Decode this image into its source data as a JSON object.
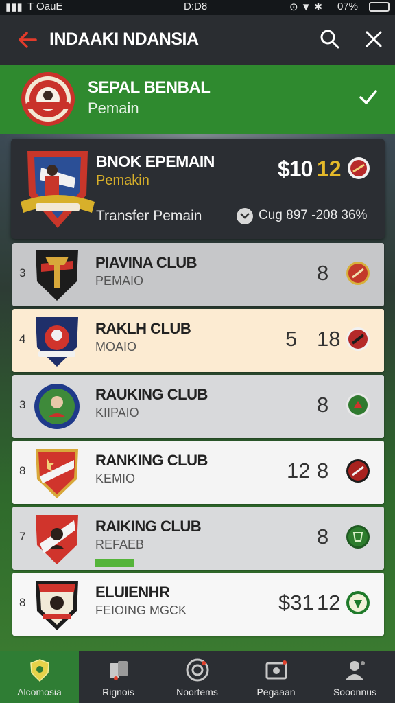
{
  "status": {
    "left": "T OauE",
    "time": "D:D8",
    "battery": "07%"
  },
  "header": {
    "title": "INDAAKI NDANSIA"
  },
  "banner": {
    "title": "SEPAL BENBAL",
    "subtitle": "Pemain"
  },
  "featured": {
    "title": "BNOK EPEMAIN",
    "subtitle": "Pemakin",
    "price": "$10",
    "price_extra": "12",
    "transfer_label": "Transfer Pemain",
    "cue_text": "Cug 897 -208 36%"
  },
  "rows": [
    {
      "rank": "3",
      "name": "PIAVINA CLUB",
      "sub": "PEMAIO",
      "value1": "",
      "value2": "8",
      "bg": "#c6c7c9",
      "badge_color": "#c33a2a"
    },
    {
      "rank": "4",
      "name": "RAKLH CLUB",
      "sub": "MOAIO",
      "value1": "5",
      "value2": "18",
      "bg": "#fcebd2",
      "badge_color": "#b52a2a"
    },
    {
      "rank": "3",
      "name": "RAUKING CLUB",
      "sub": "KIIPAIO",
      "value1": "",
      "value2": "8",
      "bg": "#d8d9db",
      "badge_color": "#2f7a2f"
    },
    {
      "rank": "8",
      "name": "RANKING CLUB",
      "sub": "KEMIO",
      "value1": "12",
      "value2": "8",
      "bg": "#f4f4f4",
      "badge_color": "#a8221f"
    },
    {
      "rank": "7",
      "name": "RAIKING CLUB",
      "sub": "REFAEB",
      "value1": "",
      "value2": "8",
      "bg": "#d9dadc",
      "badge_color": "#2d7d2d"
    },
    {
      "rank": "8",
      "name": "ELUIENHR",
      "sub": "FEIOING MGCK",
      "value1": "$31",
      "value2": "12",
      "bg": "#f7f7f7",
      "badge_color": "#1f7a2a"
    }
  ],
  "nav": [
    {
      "label": "Alcomosia",
      "icon": "shield-icon",
      "active": true
    },
    {
      "label": "Rignois",
      "icon": "cards-icon",
      "active": false
    },
    {
      "label": "Noortems",
      "icon": "target-icon",
      "active": false
    },
    {
      "label": "Pegaaan",
      "icon": "image-icon",
      "active": false
    },
    {
      "label": "Sooonnus",
      "icon": "person-icon",
      "active": false
    }
  ],
  "colors": {
    "accent_green": "#2f8a2f",
    "dark": "#2b2e33",
    "gold": "#e4b92a",
    "red": "#d93a2b"
  }
}
